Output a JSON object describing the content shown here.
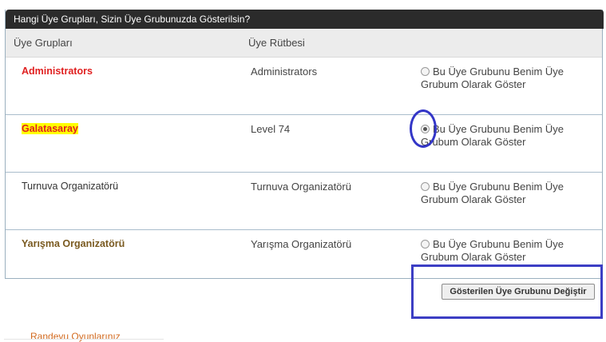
{
  "panel": {
    "title": "Hangi Üye Grupları, Sizin Üye Grubunuzda Gösterilsin?",
    "columns": {
      "groups": "Üye Grupları",
      "rank": "Üye Rütbesi"
    }
  },
  "rows": [
    {
      "group": "Administrators",
      "group_color": "#e02020",
      "highlight": null,
      "rank": "Administrators",
      "option": "Bu Üye Grubunu Benim Üye Grubum Olarak Göster",
      "selected": false
    },
    {
      "group": "Galatasaray",
      "group_color": "#e02020",
      "highlight": "#ffff00",
      "rank": "Level 74",
      "option": "Bu Üye Grubunu Benim Üye Grubum Olarak Göster",
      "selected": true
    },
    {
      "group": "Turnuva Organizatörü",
      "group_color": "#333333",
      "highlight": null,
      "rank": "Turnuva Organizatörü",
      "option": "Bu Üye Grubunu Benim Üye Grubum Olarak Göster",
      "selected": false
    },
    {
      "group": "Yarışma Organizatörü",
      "group_color": "#7a5a20",
      "highlight": null,
      "rank": "Yarışma Organizatörü",
      "option": "Bu Üye Grubunu Benim Üye Grubum Olarak Göster",
      "selected": false
    }
  ],
  "actions": {
    "change_button": "Gösterilen Üye Grubunu Değiştir"
  },
  "footer": {
    "link_text": "Randevu Oyunlarınız"
  }
}
